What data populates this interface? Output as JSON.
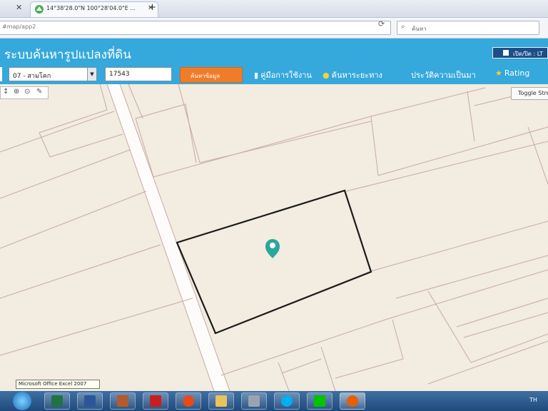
{
  "browser": {
    "tab_title": "14°38'28.0\"N 100°28'04.0\"E ...",
    "tab_close": "✕",
    "new_tab": "+",
    "url": "#map/app2",
    "search_placeholder": "ค้นหา",
    "search_icon": "magnifier-icon",
    "reload_icon": "reload-icon"
  },
  "app": {
    "title": "ระบบค้นหารูปแปลงที่ดิน",
    "header_toggle": "เปิด/ปิด : LT"
  },
  "toolbar": {
    "amphoe_select": "07 - สามโคก",
    "parcel_number": "17543",
    "find_button": "ค้นหาข้อมูล",
    "links": [
      {
        "label": "คู่มือการใช้งาน",
        "icon": "book-icon"
      },
      {
        "label": "ค้นหาระยะทาง",
        "icon": "distance-icon"
      },
      {
        "label": "ประวัติความเป็นมา",
        "icon": "history-icon"
      },
      {
        "label": "Rating",
        "icon": "star-icon"
      }
    ]
  },
  "map": {
    "tools": [
      "↕",
      "⊕",
      "⊙",
      "✎"
    ],
    "toggle_button": "Toggle Street",
    "colors": {
      "background": "#f2ece1",
      "parcel_lines": "#c9a9a6",
      "road": "#ffffff",
      "selected_parcel": "#1a1a1a",
      "marker": "#2aa6a0"
    }
  },
  "taskbar": {
    "tooltip": "Microsoft Office Excel 2007",
    "tray_text": "TH",
    "apps": [
      {
        "name": "excel",
        "color": "#217346"
      },
      {
        "name": "word",
        "color": "#2b579a"
      },
      {
        "name": "pdf",
        "color": "#c71f1f"
      },
      {
        "name": "foxit",
        "color": "#e64a19"
      },
      {
        "name": "explorer",
        "color": "#e8c45a"
      },
      {
        "name": "picture",
        "color": "#9aa4b1"
      },
      {
        "name": "skype",
        "color": "#00aff0"
      },
      {
        "name": "line",
        "color": "#00c300"
      },
      {
        "name": "firefox",
        "color": "#e66000"
      }
    ]
  }
}
